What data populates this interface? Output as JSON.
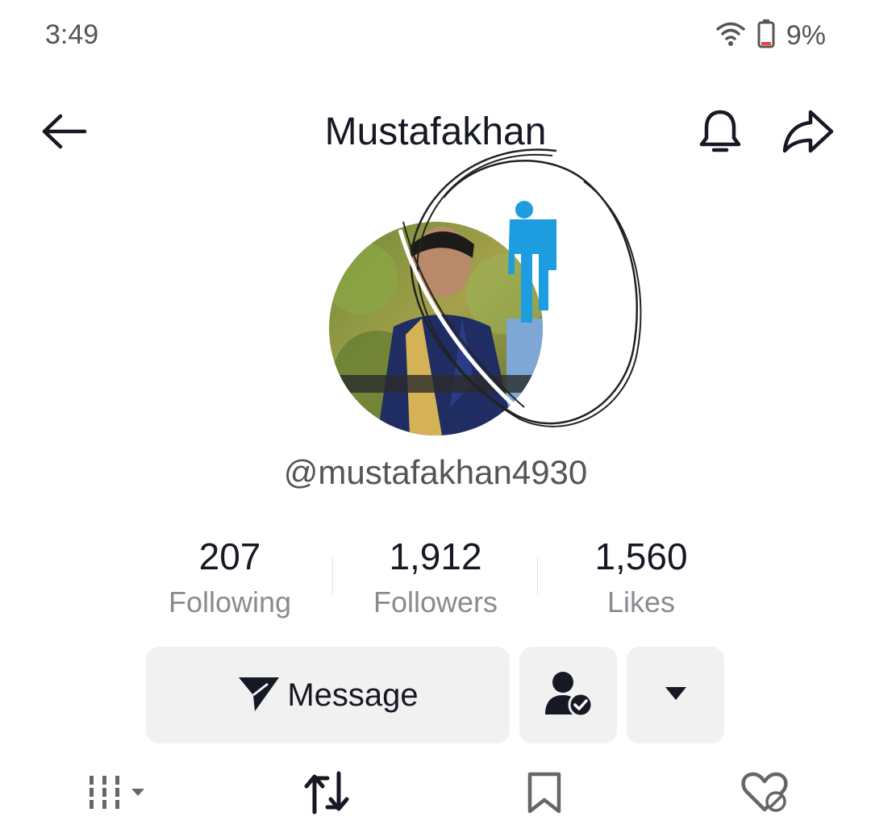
{
  "status_bar": {
    "time": "3:49",
    "battery": "9%",
    "wifi_icon": "wifi-icon",
    "battery_icon": "battery-low-icon"
  },
  "header": {
    "title": "Mustafakhan",
    "back_icon": "arrow-left-icon",
    "bell_icon": "bell-icon",
    "share_icon": "share-arrow-icon"
  },
  "profile": {
    "handle": "@mustafakhan4930",
    "avatar": "profile-photo"
  },
  "stats": [
    {
      "value": "207",
      "label": "Following"
    },
    {
      "value": "1,912",
      "label": "Followers"
    },
    {
      "value": "1,560",
      "label": "Likes"
    }
  ],
  "actions": {
    "message_label": "Message",
    "message_icon": "send-icon",
    "following_icon": "person-check-icon",
    "more_icon": "caret-down-icon"
  },
  "tabs": [
    {
      "icon": "grid-icon"
    },
    {
      "icon": "repost-icon"
    },
    {
      "icon": "bookmark-icon"
    },
    {
      "icon": "heart-hidden-icon"
    }
  ],
  "colors": {
    "accent_blue": "#1d9de0",
    "battery_low": "#e5483d",
    "button_bg": "#f1f1f2"
  }
}
